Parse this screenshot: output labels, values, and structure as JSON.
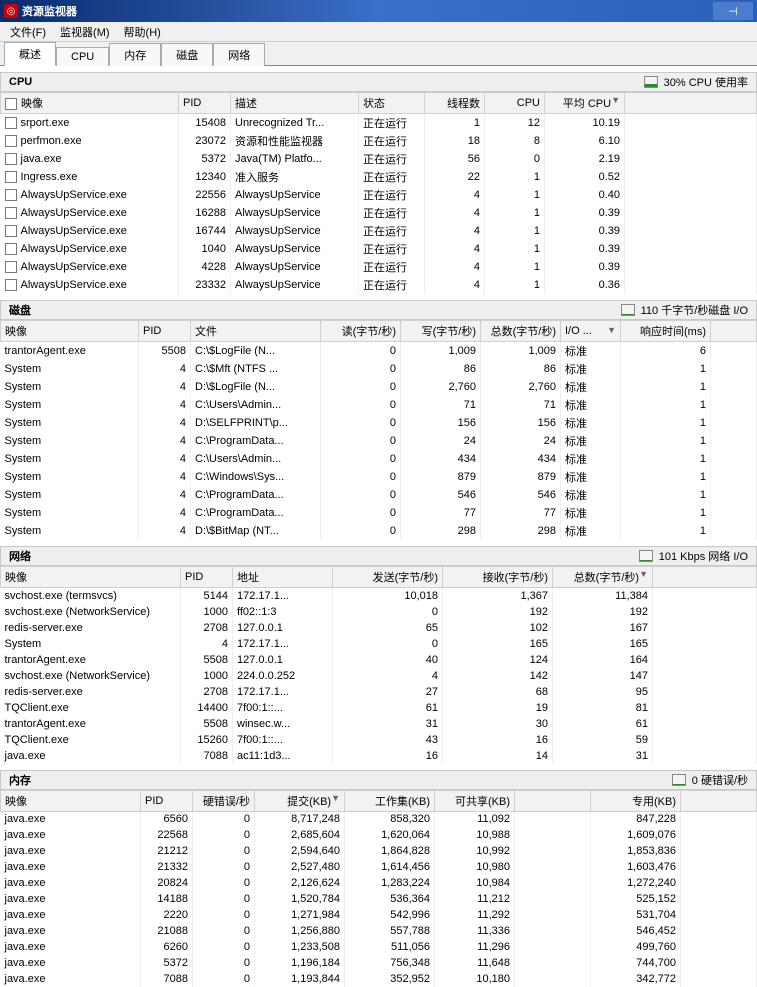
{
  "window": {
    "title": "资源监视器"
  },
  "menu": {
    "file": "文件(F)",
    "monitor": "监视器(M)",
    "help": "帮助(H)"
  },
  "tabs": {
    "overview": "概述",
    "cpu": "CPU",
    "memory": "内存",
    "disk": "磁盘",
    "network": "网络"
  },
  "cpu": {
    "title": "CPU",
    "metric": "30% CPU 使用率",
    "headers": {
      "image": "映像",
      "pid": "PID",
      "desc": "描述",
      "status": "状态",
      "threads": "线程数",
      "cpu": "CPU",
      "avg": "平均 CPU"
    },
    "rows": [
      {
        "image": "srport.exe",
        "pid": "15408",
        "desc": "Unrecognized Tr...",
        "status": "正在运行",
        "threads": "1",
        "cpu": "12",
        "avg": "10.19"
      },
      {
        "image": "perfmon.exe",
        "pid": "23072",
        "desc": "资源和性能监视器",
        "status": "正在运行",
        "threads": "18",
        "cpu": "8",
        "avg": "6.10"
      },
      {
        "image": "java.exe",
        "pid": "5372",
        "desc": "Java(TM) Platfo...",
        "status": "正在运行",
        "threads": "56",
        "cpu": "0",
        "avg": "2.19"
      },
      {
        "image": "Ingress.exe",
        "pid": "12340",
        "desc": "准入服务",
        "status": "正在运行",
        "threads": "22",
        "cpu": "1",
        "avg": "0.52"
      },
      {
        "image": "AlwaysUpService.exe",
        "pid": "22556",
        "desc": "AlwaysUpService",
        "status": "正在运行",
        "threads": "4",
        "cpu": "1",
        "avg": "0.40"
      },
      {
        "image": "AlwaysUpService.exe",
        "pid": "16288",
        "desc": "AlwaysUpService",
        "status": "正在运行",
        "threads": "4",
        "cpu": "1",
        "avg": "0.39"
      },
      {
        "image": "AlwaysUpService.exe",
        "pid": "16744",
        "desc": "AlwaysUpService",
        "status": "正在运行",
        "threads": "4",
        "cpu": "1",
        "avg": "0.39"
      },
      {
        "image": "AlwaysUpService.exe",
        "pid": "1040",
        "desc": "AlwaysUpService",
        "status": "正在运行",
        "threads": "4",
        "cpu": "1",
        "avg": "0.39"
      },
      {
        "image": "AlwaysUpService.exe",
        "pid": "4228",
        "desc": "AlwaysUpService",
        "status": "正在运行",
        "threads": "4",
        "cpu": "1",
        "avg": "0.39"
      },
      {
        "image": "AlwaysUpService.exe",
        "pid": "23332",
        "desc": "AlwaysUpService",
        "status": "正在运行",
        "threads": "4",
        "cpu": "1",
        "avg": "0.36"
      }
    ]
  },
  "disk": {
    "title": "磁盘",
    "metric": "110 千字节/秒磁盘 I/O",
    "headers": {
      "image": "映像",
      "pid": "PID",
      "file": "文件",
      "read": "读(字节/秒)",
      "write": "写(字节/秒)",
      "total": "总数(字节/秒)",
      "io": "I/O ...",
      "rt": "响应时间(ms)"
    },
    "rows": [
      {
        "image": "trantorAgent.exe",
        "pid": "5508",
        "file": "C:\\$LogFile (N...",
        "read": "0",
        "write": "1,009",
        "total": "1,009",
        "io": "标准",
        "rt": "6"
      },
      {
        "image": "System",
        "pid": "4",
        "file": "C:\\$Mft (NTFS ...",
        "read": "0",
        "write": "86",
        "total": "86",
        "io": "标准",
        "rt": "1"
      },
      {
        "image": "System",
        "pid": "4",
        "file": "D:\\$LogFile (N...",
        "read": "0",
        "write": "2,760",
        "total": "2,760",
        "io": "标准",
        "rt": "1"
      },
      {
        "image": "System",
        "pid": "4",
        "file": "C:\\Users\\Admin...",
        "read": "0",
        "write": "71",
        "total": "71",
        "io": "标准",
        "rt": "1"
      },
      {
        "image": "System",
        "pid": "4",
        "file": "D:\\SELFPRINT\\p...",
        "read": "0",
        "write": "156",
        "total": "156",
        "io": "标准",
        "rt": "1"
      },
      {
        "image": "System",
        "pid": "4",
        "file": "C:\\ProgramData...",
        "read": "0",
        "write": "24",
        "total": "24",
        "io": "标准",
        "rt": "1"
      },
      {
        "image": "System",
        "pid": "4",
        "file": "C:\\Users\\Admin...",
        "read": "0",
        "write": "434",
        "total": "434",
        "io": "标准",
        "rt": "1"
      },
      {
        "image": "System",
        "pid": "4",
        "file": "C:\\Windows\\Sys...",
        "read": "0",
        "write": "879",
        "total": "879",
        "io": "标准",
        "rt": "1"
      },
      {
        "image": "System",
        "pid": "4",
        "file": "C:\\ProgramData...",
        "read": "0",
        "write": "546",
        "total": "546",
        "io": "标准",
        "rt": "1"
      },
      {
        "image": "System",
        "pid": "4",
        "file": "C:\\ProgramData...",
        "read": "0",
        "write": "77",
        "total": "77",
        "io": "标准",
        "rt": "1"
      },
      {
        "image": "System",
        "pid": "4",
        "file": "D:\\$BitMap (NT...",
        "read": "0",
        "write": "298",
        "total": "298",
        "io": "标准",
        "rt": "1"
      }
    ]
  },
  "network": {
    "title": "网络",
    "metric": "101 Kbps 网络 I/O",
    "headers": {
      "image": "映像",
      "pid": "PID",
      "addr": "地址",
      "send": "发送(字节/秒)",
      "recv": "接收(字节/秒)",
      "total": "总数(字节/秒)"
    },
    "rows": [
      {
        "image": "svchost.exe (termsvcs)",
        "pid": "5144",
        "addr": "172.17.1...",
        "send": "10,018",
        "recv": "1,367",
        "total": "11,384"
      },
      {
        "image": "svchost.exe (NetworkService)",
        "pid": "1000",
        "addr": "ff02::1:3",
        "send": "0",
        "recv": "192",
        "total": "192"
      },
      {
        "image": "redis-server.exe",
        "pid": "2708",
        "addr": "127.0.0.1",
        "send": "65",
        "recv": "102",
        "total": "167"
      },
      {
        "image": "System",
        "pid": "4",
        "addr": "172.17.1...",
        "send": "0",
        "recv": "165",
        "total": "165"
      },
      {
        "image": "trantorAgent.exe",
        "pid": "5508",
        "addr": "127.0.0.1",
        "send": "40",
        "recv": "124",
        "total": "164"
      },
      {
        "image": "svchost.exe (NetworkService)",
        "pid": "1000",
        "addr": "224.0.0.252",
        "send": "4",
        "recv": "142",
        "total": "147"
      },
      {
        "image": "redis-server.exe",
        "pid": "2708",
        "addr": "172.17.1...",
        "send": "27",
        "recv": "68",
        "total": "95"
      },
      {
        "image": "TQClient.exe",
        "pid": "14400",
        "addr": "7f00:1::...",
        "send": "61",
        "recv": "19",
        "total": "81"
      },
      {
        "image": "trantorAgent.exe",
        "pid": "5508",
        "addr": "winsec.w...",
        "send": "31",
        "recv": "30",
        "total": "61"
      },
      {
        "image": "TQClient.exe",
        "pid": "15260",
        "addr": "7f00:1::...",
        "send": "43",
        "recv": "16",
        "total": "59"
      },
      {
        "image": "java.exe",
        "pid": "7088",
        "addr": "ac11:1d3...",
        "send": "16",
        "recv": "14",
        "total": "31"
      }
    ]
  },
  "memory": {
    "title": "内存",
    "metric": "0 硬错误/秒",
    "headers": {
      "image": "映像",
      "pid": "PID",
      "hf": "硬错误/秒",
      "commit": "提交(KB)",
      "ws": "工作集(KB)",
      "share": "可共享(KB)",
      "priv": "专用(KB)"
    },
    "rows": [
      {
        "image": "java.exe",
        "pid": "6560",
        "hf": "0",
        "commit": "8,717,248",
        "ws": "858,320",
        "share": "11,092",
        "priv": "847,228"
      },
      {
        "image": "java.exe",
        "pid": "22568",
        "hf": "0",
        "commit": "2,685,604",
        "ws": "1,620,064",
        "share": "10,988",
        "priv": "1,609,076"
      },
      {
        "image": "java.exe",
        "pid": "21212",
        "hf": "0",
        "commit": "2,594,640",
        "ws": "1,864,828",
        "share": "10,992",
        "priv": "1,853,836"
      },
      {
        "image": "java.exe",
        "pid": "21332",
        "hf": "0",
        "commit": "2,527,480",
        "ws": "1,614,456",
        "share": "10,980",
        "priv": "1,603,476"
      },
      {
        "image": "java.exe",
        "pid": "20824",
        "hf": "0",
        "commit": "2,126,624",
        "ws": "1,283,224",
        "share": "10,984",
        "priv": "1,272,240"
      },
      {
        "image": "java.exe",
        "pid": "14188",
        "hf": "0",
        "commit": "1,520,784",
        "ws": "536,364",
        "share": "11,212",
        "priv": "525,152"
      },
      {
        "image": "java.exe",
        "pid": "2220",
        "hf": "0",
        "commit": "1,271,984",
        "ws": "542,996",
        "share": "11,292",
        "priv": "531,704"
      },
      {
        "image": "java.exe",
        "pid": "21088",
        "hf": "0",
        "commit": "1,256,880",
        "ws": "557,788",
        "share": "11,336",
        "priv": "546,452"
      },
      {
        "image": "java.exe",
        "pid": "6260",
        "hf": "0",
        "commit": "1,233,508",
        "ws": "511,056",
        "share": "11,296",
        "priv": "499,760"
      },
      {
        "image": "java.exe",
        "pid": "5372",
        "hf": "0",
        "commit": "1,196,184",
        "ws": "756,348",
        "share": "11,648",
        "priv": "744,700"
      },
      {
        "image": "java.exe",
        "pid": "7088",
        "hf": "0",
        "commit": "1,193,844",
        "ws": "352,952",
        "share": "10,180",
        "priv": "342,772"
      }
    ]
  }
}
